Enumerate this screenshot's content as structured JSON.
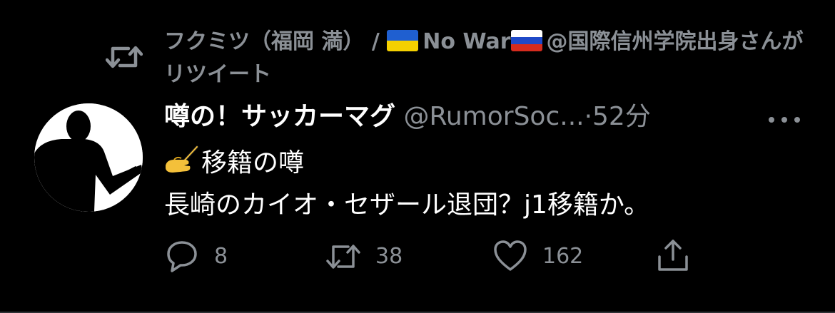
{
  "retweet": {
    "prefix": "フクミツ（福岡 満） / ",
    "mid": "No War",
    "suffix": "@国際信州学院出身さんがリツイート",
    "icon": "retweet-icon"
  },
  "tweet": {
    "display_name": "噂の！サッカーマグ",
    "handle": "@RumorSoc...",
    "dot": "·",
    "time": "52分",
    "line1_text": "移籍の噂",
    "line2": "長崎のカイオ・セザール退団？j1移籍か。"
  },
  "actions": {
    "replies": "8",
    "retweets": "38",
    "likes": "162"
  },
  "colors": {
    "background": "#000000",
    "muted": "#8b9096",
    "text": "#ffffff"
  }
}
